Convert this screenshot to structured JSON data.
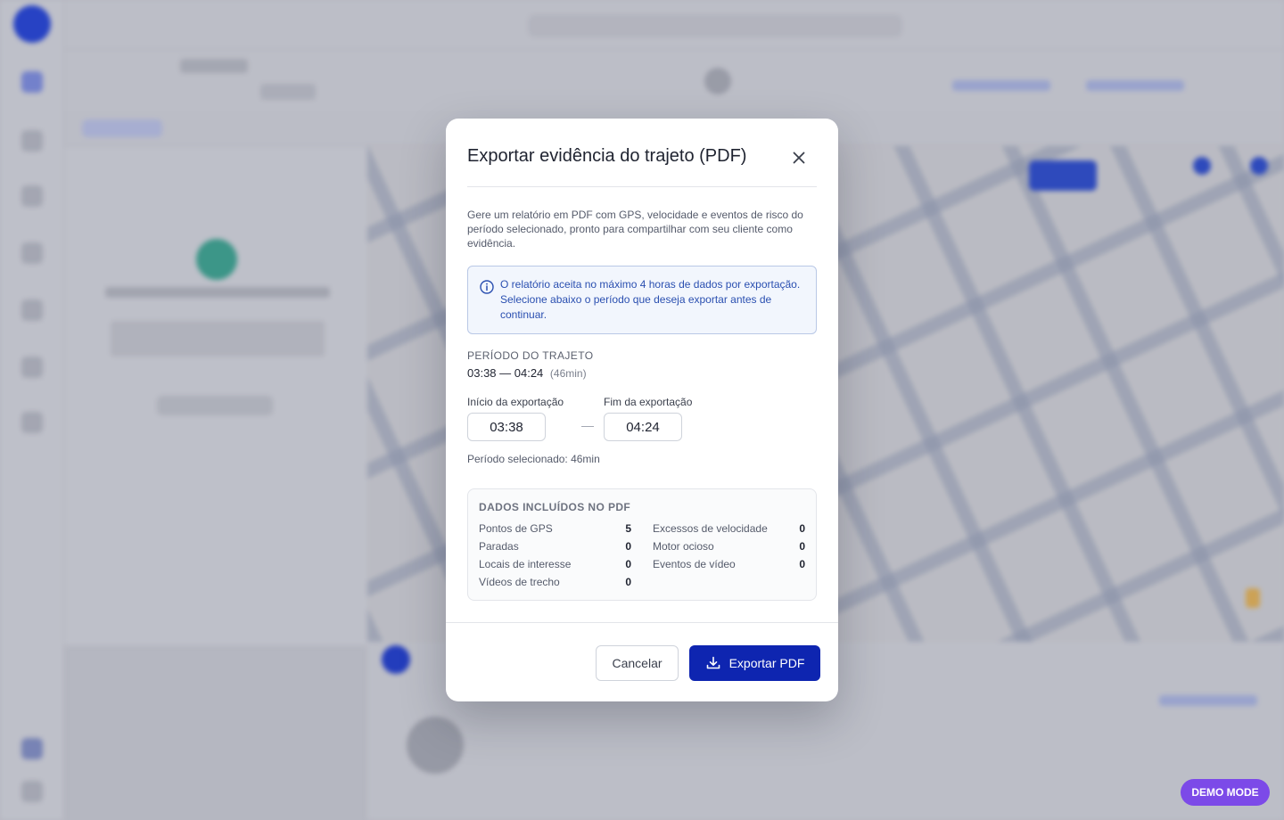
{
  "modal": {
    "title": "Exportar evidência do trajeto (PDF)",
    "description": "Gere um relatório em PDF com GPS, velocidade e eventos de risco do período selecionado, pronto para compartilhar com seu cliente como evidência.",
    "info_text": "O relatório aceita no máximo 4 horas de dados por exportação. Selecione abaixo o período que deseja exportar antes de continuar.",
    "period": {
      "label": "PERÍODO DO TRAJETO",
      "range": "03:38 — 04:24",
      "duration": "(46min)"
    },
    "start": {
      "label": "Início da exportação",
      "value": "03:38"
    },
    "end": {
      "label": "Fim da exportação",
      "value": "04:24"
    },
    "range_separator": "—",
    "selected_period": "Período selecionado: 46min",
    "data_included": {
      "title": "DADOS INCLUÍDOS NO PDF",
      "items": [
        {
          "label": "Pontos de GPS",
          "value": "5"
        },
        {
          "label": "Excessos de velocidade",
          "value": "0"
        },
        {
          "label": "Paradas",
          "value": "0"
        },
        {
          "label": "Motor ocioso",
          "value": "0"
        },
        {
          "label": "Locais de interesse",
          "value": "0"
        },
        {
          "label": "Eventos de vídeo",
          "value": "0"
        },
        {
          "label": "Vídeos de trecho",
          "value": "0"
        }
      ]
    },
    "cancel_label": "Cancelar",
    "export_label": "Exportar PDF",
    "close_icon": "close-icon",
    "info_icon": "info-icon",
    "export_icon": "download-icon"
  },
  "demo_badge": "DEMO MODE",
  "colors": {
    "primary": "#0e25b0",
    "info_text": "#2a4fb0",
    "demo_badge": "#7c4ae8"
  }
}
